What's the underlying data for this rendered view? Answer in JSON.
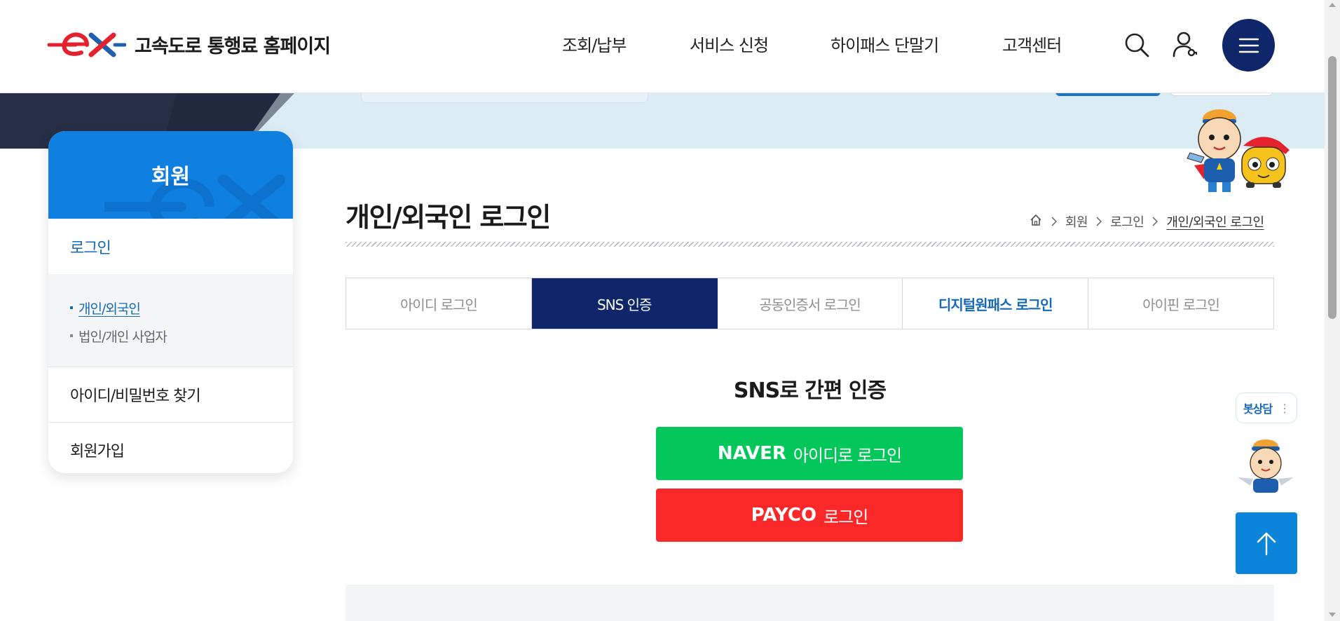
{
  "header": {
    "site_title": "고속도로 통행료 홈페이지",
    "nav": [
      "조회/납부",
      "서비스 신청",
      "하이패스 단말기",
      "고객센터"
    ],
    "icons": [
      "search-icon",
      "user-login-icon",
      "hamburger-menu-icon"
    ],
    "menu_color": "#10266a"
  },
  "sidebar": {
    "title": "회원",
    "items": {
      "login": "로그인",
      "sub": [
        "개인/외국인",
        "법인/개인 사업자"
      ],
      "find": "아이디/비밀번호 찾기",
      "join": "회원가입"
    },
    "accent": "#0f7fe0"
  },
  "main": {
    "title": "개인/외국인 로그인",
    "breadcrumb": [
      "회원",
      "로그인",
      "개인/외국인 로그인"
    ],
    "tabs": [
      "아이디 로그인",
      "SNS 인증",
      "공동인증서 로그인",
      "디지털원패스 로그인",
      "아이핀 로그인"
    ],
    "active_tab": "SNS 인증",
    "sns_title": "SNS로 간편 인증",
    "naver": {
      "brand": "NAVER",
      "label": "아이디로 로그인",
      "color": "#03c75a"
    },
    "payco": {
      "brand": "PAYCO",
      "label": "로그인",
      "color": "#fa2828"
    }
  },
  "floating": {
    "chat_label": "봇상담",
    "chat_more": "⋮",
    "top_button_icon": "arrow-up-icon"
  }
}
